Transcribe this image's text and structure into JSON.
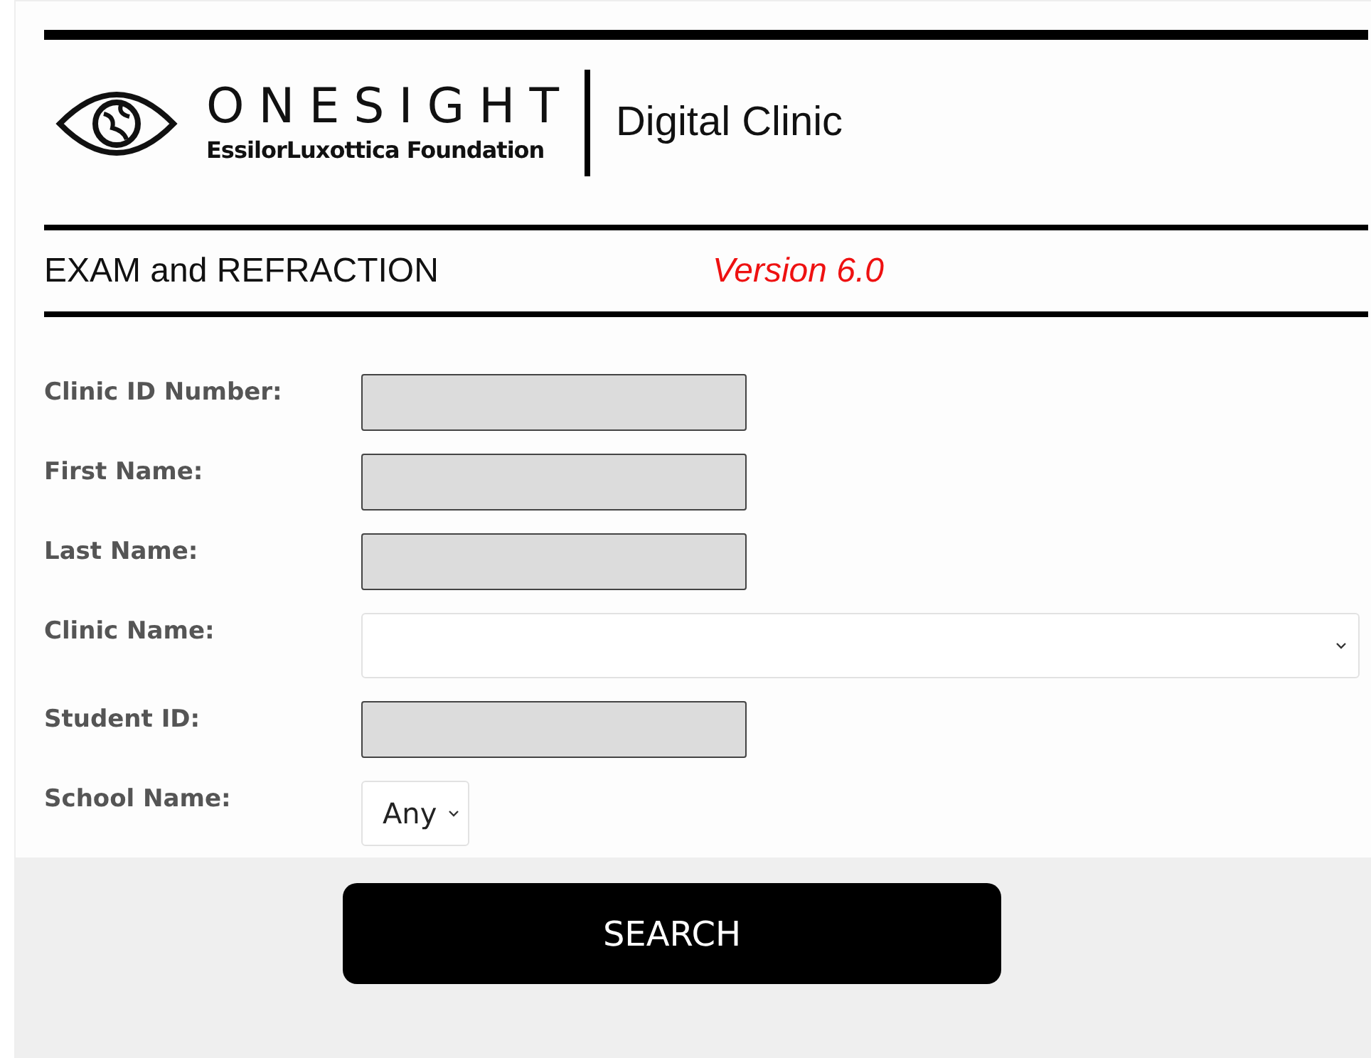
{
  "logo": {
    "wordmark": "ONESIGHT",
    "tagline": "EssilorLuxottica Foundation"
  },
  "app_title": "Digital Clinic",
  "section": {
    "title": "EXAM and REFRACTION",
    "version": "Version 6.0"
  },
  "fields": [
    {
      "label": "Clinic ID Number:",
      "kind": "text"
    },
    {
      "label": "First Name:",
      "kind": "text"
    },
    {
      "label": "Last Name:",
      "kind": "text"
    },
    {
      "label": "Clinic Name:",
      "kind": "select-wide"
    },
    {
      "label": "Student ID:",
      "kind": "text"
    },
    {
      "label": "School Name:",
      "kind": "select",
      "value": "Any"
    }
  ],
  "search_button": "SEARCH"
}
